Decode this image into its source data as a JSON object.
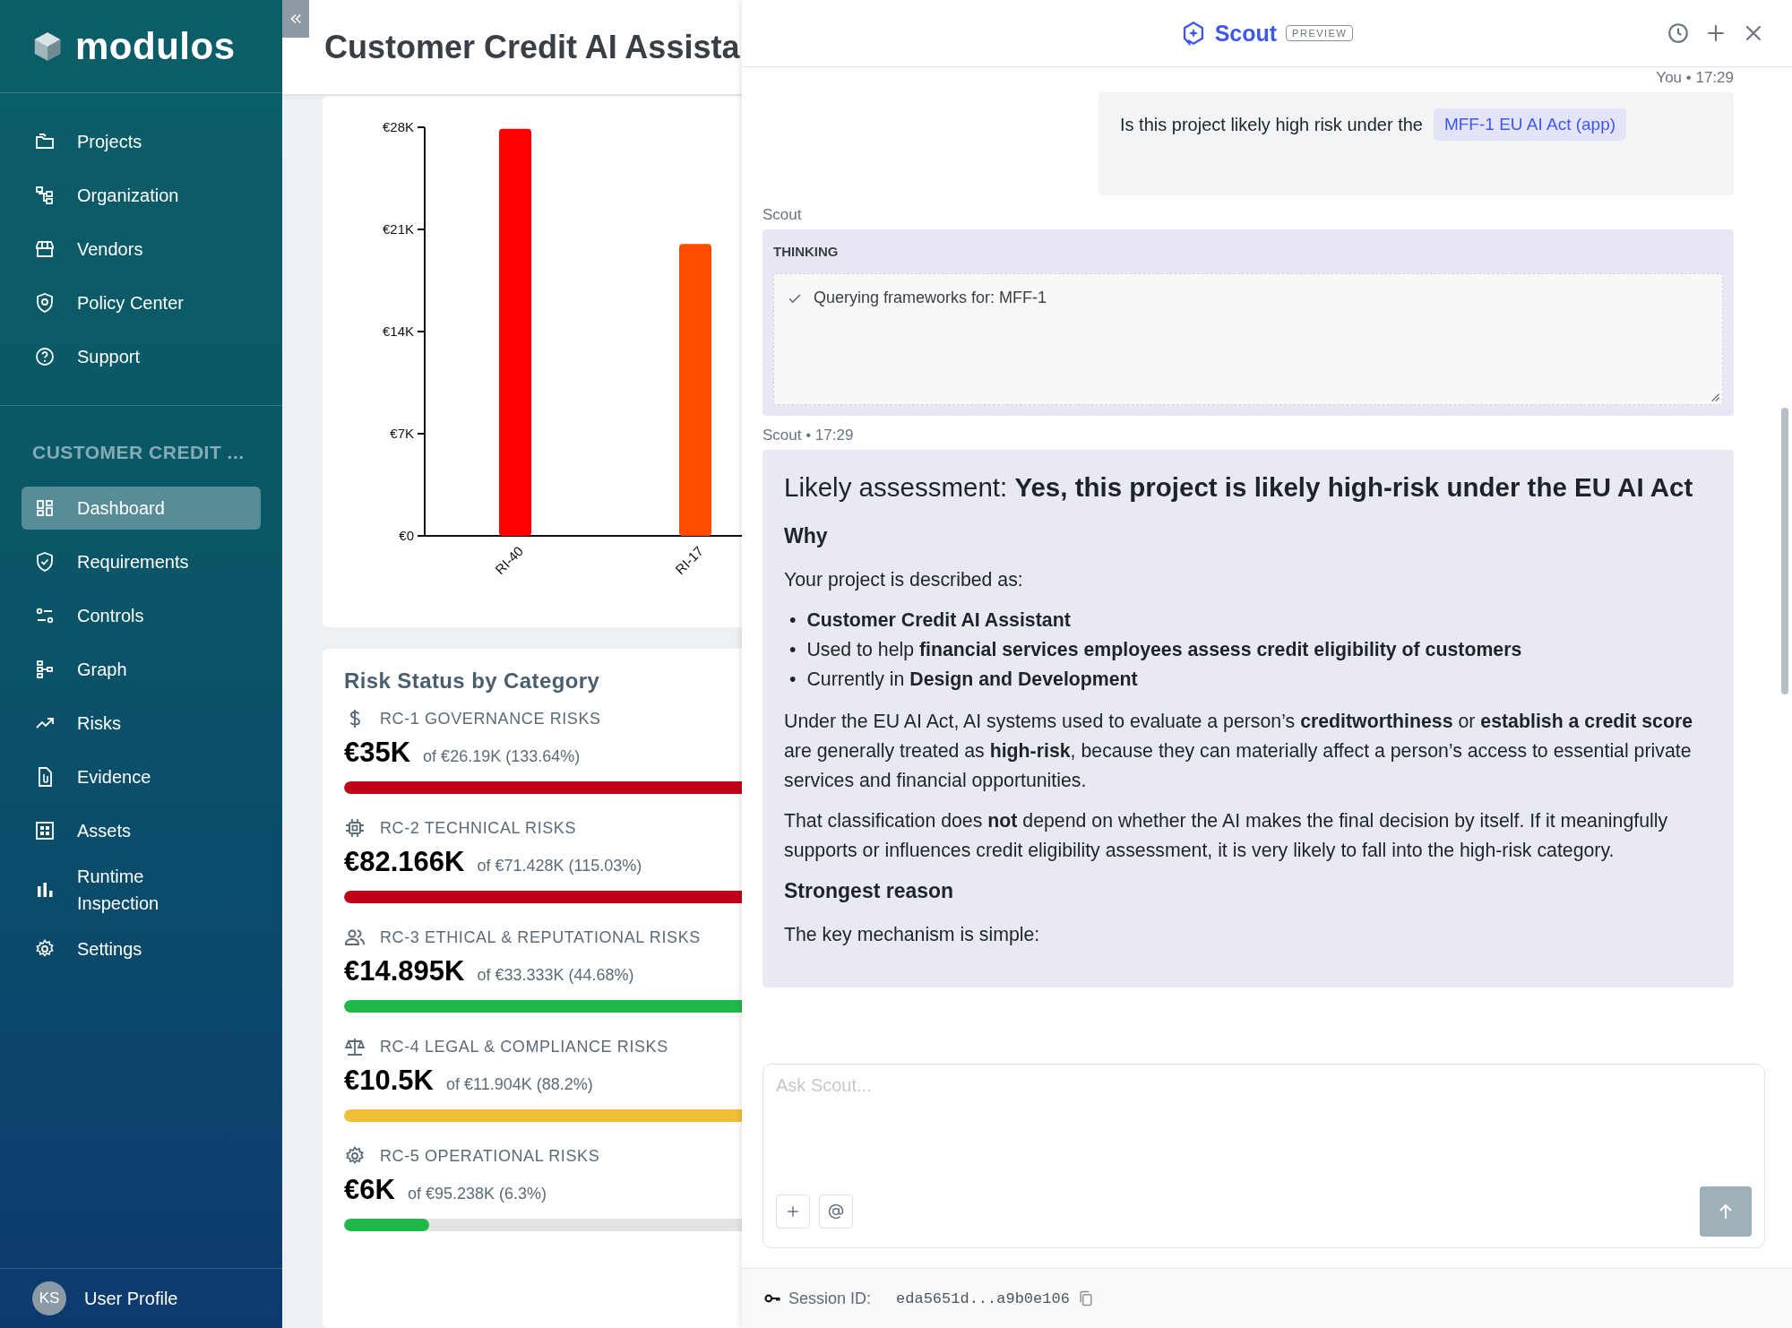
{
  "sidebar": {
    "logo": "modulos",
    "nav": [
      {
        "label": "Projects"
      },
      {
        "label": "Organization"
      },
      {
        "label": "Vendors"
      },
      {
        "label": "Policy Center"
      },
      {
        "label": "Support"
      }
    ],
    "section_title": "CUSTOMER CREDIT ...",
    "items": [
      {
        "label": "Dashboard",
        "selected": true
      },
      {
        "label": "Requirements",
        "selected": false
      },
      {
        "label": "Controls",
        "selected": false
      },
      {
        "label": "Graph",
        "selected": false
      },
      {
        "label": "Risks",
        "selected": false
      },
      {
        "label": "Evidence",
        "selected": false
      },
      {
        "label": "Assets",
        "selected": false
      },
      {
        "label": "Runtime Inspection",
        "selected": false
      },
      {
        "label": "Settings",
        "selected": false
      }
    ],
    "user": {
      "initials": "KS",
      "label": "User Profile"
    }
  },
  "page": {
    "title": "Customer Credit AI Assista"
  },
  "cost_chart": {
    "chart_data": {
      "type": "bar",
      "categories": [
        "RI-40",
        "RI-17"
      ],
      "series": [
        {
          "color": "#fe0000",
          "values": [
            27900,
            null
          ]
        },
        {
          "color": "#ff4d00",
          "values": [
            null,
            20000
          ]
        }
      ],
      "ylim": [
        0,
        28000
      ],
      "yticks": [
        {
          "value": 0,
          "label": "€0"
        },
        {
          "value": 7000,
          "label": "€7K"
        },
        {
          "value": 14000,
          "label": "€14K"
        },
        {
          "value": 21000,
          "label": "€21K"
        },
        {
          "value": 28000,
          "label": "€28K"
        }
      ]
    }
  },
  "risk_status": {
    "title": "Risk Status by Category",
    "categories": [
      {
        "label": "RC-1 GOVERNANCE RISKS",
        "value": "€35K",
        "detail": "of €26.19K (133.64%)",
        "level": 1,
        "color": "#c00018"
      },
      {
        "label": "RC-2 TECHNICAL RISKS",
        "value": "€82.166K",
        "detail": "of €71.428K (115.03%)",
        "level": 1,
        "color": "#c00018"
      },
      {
        "label": "RC-3 ETHICAL & REPUTATIONAL RISKS",
        "value": "€14.895K",
        "detail": "of €33.333K (44.68%)",
        "level": 0.4468,
        "color": "#1fb84a"
      },
      {
        "label": "RC-4 LEGAL & COMPLIANCE RISKS",
        "value": "€10.5K",
        "detail": "of €11.904K (88.2%)",
        "level": 0.882,
        "color": "#f0bf38"
      },
      {
        "label": "RC-5 OPERATIONAL RISKS",
        "value": "€6K",
        "detail": "of €95.238K (6.3%)",
        "level": 0.063,
        "color": "#1fb84a"
      }
    ]
  },
  "scout": {
    "title": "Scout",
    "badge": "PREVIEW",
    "messages": [
      {
        "kind": "user",
        "meta": "You • 17:29",
        "text": "Is this project likely high risk under the",
        "chip": "MFF-1 EU AI Act (app)"
      },
      {
        "kind": "thinking",
        "meta": "Scout",
        "heading": "THINKING",
        "steps": [
          {
            "text": "Querying frameworks for: MFF-1",
            "done": true
          }
        ]
      },
      {
        "kind": "answer",
        "meta": "Scout • 17:29",
        "blocks": [
          {
            "kind": "h1",
            "text": "Likely assessment: **Yes, this project is likely high-risk under the EU AI Act**"
          },
          {
            "kind": "h2",
            "text": "Why"
          },
          {
            "kind": "p",
            "text": "Your project is described as:"
          },
          {
            "kind": "ul",
            "marker": "•",
            "items": [
              "**Customer Credit AI Assistant**",
              "Used to help **financial services employees assess credit eligibility of customers**",
              "Currently in **Design and Development**"
            ]
          },
          {
            "kind": "p",
            "text": "Under the EU AI Act, AI systems used to evaluate a person’s **creditworthiness** or **establish a credit score** are generally treated as **high-risk**, because they can materially affect a person’s access to essential private services and financial opportunities."
          },
          {
            "kind": "p",
            "text": "That classification does **not** depend on whether the AI makes the final decision by itself. If it meaningfully supports or influences credit eligibility assessment, it is very likely to fall into the high-risk category."
          },
          {
            "kind": "h2",
            "text": "Strongest reason"
          },
          {
            "kind": "p",
            "text": "The key mechanism is simple:"
          }
        ]
      }
    ],
    "input": {
      "placeholder": "Ask Scout..."
    },
    "session": {
      "label": "Session ID:",
      "value": "eda5651d...a9b0e106"
    }
  }
}
